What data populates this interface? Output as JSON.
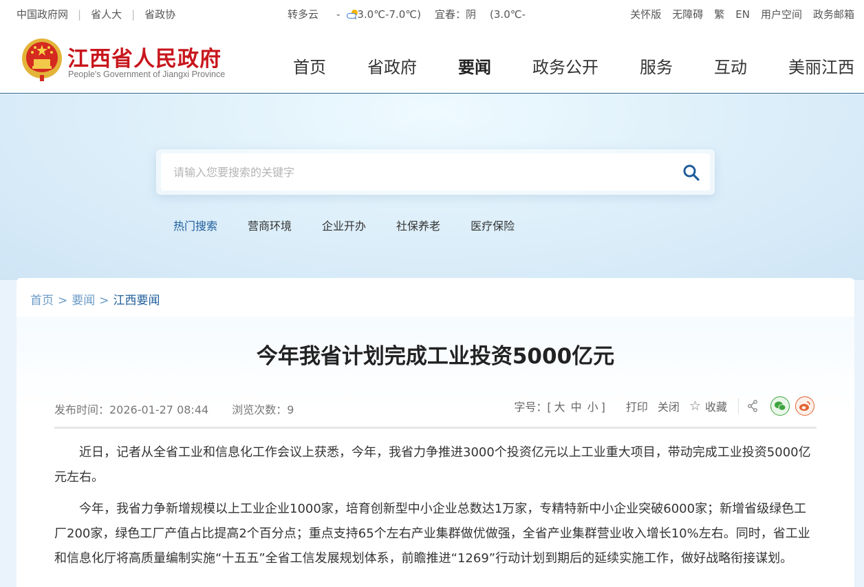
{
  "topbar": {
    "left_links": [
      "中国政府网",
      "省人大",
      "省政协"
    ],
    "weather": {
      "city1_condition": "转多云",
      "dash": "-",
      "city1_temp": "(3.0℃-7.0℃)",
      "city2": "宜春：阴",
      "city2_temp": "(3.0℃-"
    },
    "right_links": [
      "关怀版",
      "无障碍",
      "繁",
      "EN",
      "用户空间",
      "政务邮箱"
    ]
  },
  "header": {
    "logo_cn": "江西省人民政府",
    "logo_en": "People's Government of Jiangxi Province",
    "nav": [
      "首页",
      "省政府",
      "要闻",
      "政务公开",
      "服务",
      "互动",
      "美丽江西"
    ],
    "active_nav": "要闻"
  },
  "search": {
    "placeholder": "请输入您要搜索的关键字",
    "hot_title": "热门搜索",
    "hot_items": [
      "营商环境",
      "企业开办",
      "社保养老",
      "医疗保险"
    ]
  },
  "breadcrumb": {
    "items": [
      "首页",
      "要闻",
      "江西要闻"
    ],
    "separator": ">"
  },
  "article": {
    "title": "今年我省计划完成工业投资5000亿元",
    "publish_time": "发布时间：2026-01-27 08:44",
    "views": "浏览次数：9",
    "font_size_label": "字号：[",
    "font_sizes": [
      "大",
      "中",
      "小"
    ],
    "font_size_close": "]",
    "print": "打印",
    "close": "关闭",
    "favorite": "收藏",
    "paragraphs": [
      "近日，记者从全省工业和信息化工作会议上获悉，今年，我省力争推进3000个投资亿元以上工业重大项目，带动完成工业投资5000亿元左右。",
      "今年，我省力争新增规模以上工业企业1000家，培育创新型中小企业总数达1万家，专精特新中小企业突破6000家；新增省级绿色工厂200家，绿色工厂产值占比提高2个百分点；重点支持65个左右产业集群做优做强，全省产业集群营业收入增长10%左右。同时，省工业和信息化厅将高质量编制实施“十五五”全省工信发展规划体系，前瞻推进“1269”行动计划到期后的延续实施工作，做好战略衔接谋划。"
    ]
  },
  "icons": {
    "emblem": "national-emblem-icon",
    "weather": "partly-cloudy-icon",
    "search": "search-icon",
    "favorite": "star-icon",
    "share": "share-icon",
    "wechat": "wechat-icon",
    "weibo": "weibo-icon"
  },
  "colors": {
    "brand_red": "#c8161d",
    "link_blue": "#1f5d9b",
    "crumb_blue": "#6a9ac6"
  }
}
